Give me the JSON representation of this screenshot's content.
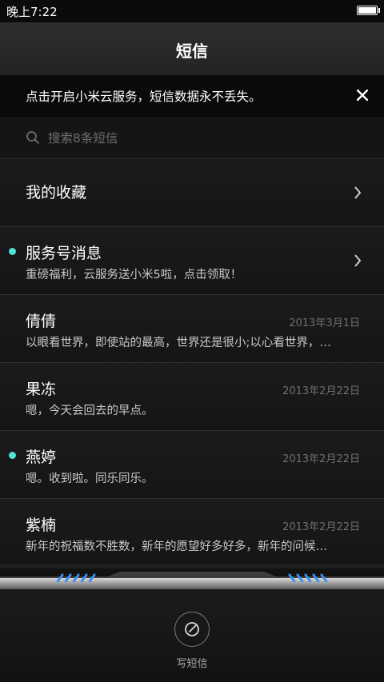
{
  "status_bar": {
    "time": "晚上7:22",
    "battery_level": 1.0
  },
  "header": {
    "title": "短信"
  },
  "cloud_banner": {
    "text": "点击开启小米云服务，短信数据永不丢失。",
    "close_icon": "close-icon"
  },
  "search": {
    "placeholder": "搜索8条短信",
    "value": ""
  },
  "favorites": {
    "label": "我的收藏"
  },
  "service": {
    "name": "服务号消息",
    "preview": "重磅福利，云服务送小米5啦，点击领取！",
    "unread": true
  },
  "conversations": [
    {
      "name": "倩倩",
      "date": "2013年3月1日",
      "preview": "以眼看世界，即使站的最高，世界还是很小;以心看世界，…",
      "unread": false
    },
    {
      "name": "果冻",
      "date": "2013年2月22日",
      "preview": "嗯，今天会回去的早点。",
      "unread": false
    },
    {
      "name": "燕婷",
      "date": "2013年2月22日",
      "preview": "嗯。收到啦。同乐同乐。",
      "unread": true
    },
    {
      "name": "紫楠",
      "date": "2013年2月22日",
      "preview": "新年的祝福数不胜数，新年的愿望好多好多，新年的问候…",
      "unread": false
    }
  ],
  "compose": {
    "label": "写短信",
    "icon": "compose-icon"
  },
  "colors": {
    "accent": "#4fe3d6",
    "stripe_blue": "#3a8fe8"
  }
}
